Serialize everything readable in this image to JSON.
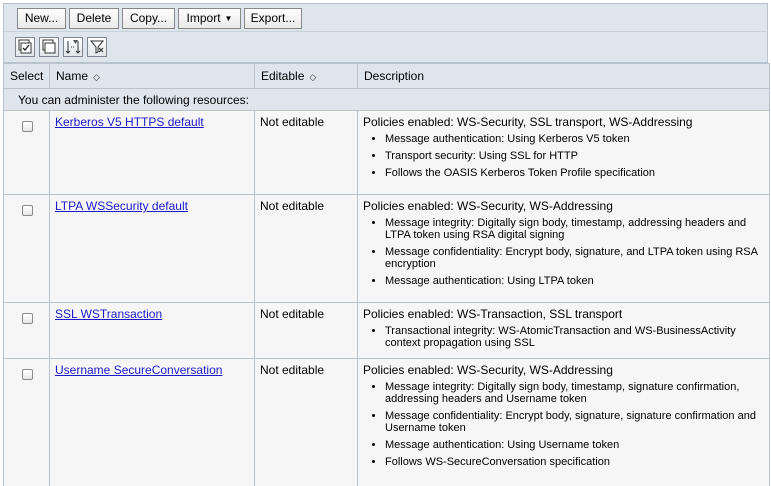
{
  "toolbar": {
    "new_label": "New...",
    "delete_label": "Delete",
    "copy_label": "Copy...",
    "import_label": "Import",
    "export_label": "Export..."
  },
  "icon_toolbar": {
    "icons": [
      "select-all-icon",
      "deselect-all-icon",
      "show-filter-icon",
      "clear-filter-icon"
    ]
  },
  "table": {
    "headers": {
      "select": "Select",
      "name": "Name",
      "editable": "Editable",
      "description": "Description"
    },
    "info_text": "You can administer the following resources:",
    "rows": [
      {
        "name": "Kerberos V5 HTTPS default",
        "editable": "Not editable",
        "policies": "Policies enabled: WS-Security, SSL transport, WS-Addressing",
        "bullets": [
          "Message authentication: Using Kerberos V5 token",
          "Transport security: Using SSL for HTTP",
          "Follows the OASIS Kerberos Token Profile specification"
        ]
      },
      {
        "name": "LTPA WSSecurity default",
        "editable": "Not editable",
        "policies": "Policies enabled: WS-Security, WS-Addressing",
        "bullets": [
          "Message integrity: Digitally sign body, timestamp, addressing headers and LTPA token using RSA digital signing",
          "Message confidentiality: Encrypt body, signature, and LTPA token using RSA encryption",
          "Message authentication: Using LTPA token"
        ]
      },
      {
        "name": "SSL WSTransaction",
        "editable": "Not editable",
        "policies": "Policies enabled: WS-Transaction, SSL transport",
        "bullets": [
          "Transactional integrity: WS-AtomicTransaction and WS-BusinessActivity context propagation using SSL"
        ]
      },
      {
        "name": "Username SecureConversation",
        "editable": "Not editable",
        "policies": "Policies enabled: WS-Security, WS-Addressing",
        "bullets": [
          "Message integrity: Digitally sign body, timestamp, signature confirmation, addressing headers and Username token",
          "Message confidentiality: Encrypt body, signature, signature confirmation and Username token",
          "Message authentication: Using Username token",
          "Follows WS-SecureConversation specification"
        ]
      }
    ]
  }
}
